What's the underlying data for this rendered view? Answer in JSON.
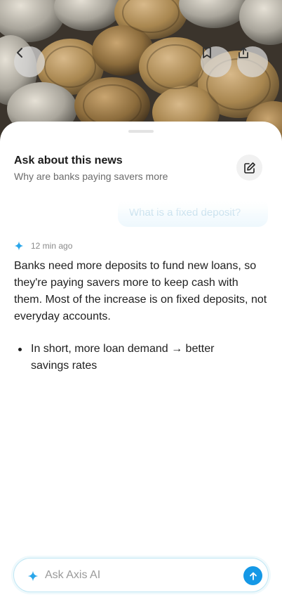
{
  "hero": {
    "image_subject": "coins-photo",
    "back_icon": "chevron-left-icon",
    "bookmark_icon": "bookmark-icon",
    "share_icon": "share-icon"
  },
  "sheet": {
    "title": "Ask about this news",
    "subtitle": "Why are banks paying savers more",
    "edit_icon": "edit-icon"
  },
  "conversation": {
    "user_message": "What is a fixed deposit?",
    "answer": {
      "assistant_icon": "sparkle-icon",
      "timestamp": "12 min ago",
      "paragraph": "Banks need more deposits to fund new loans, so they're paying savers more to keep cash with them. Most of the increase is on fixed deposits, not everyday accounts.",
      "bullets": [
        "In short, more loan demand → better savings rates"
      ]
    }
  },
  "composer": {
    "placeholder": "Ask Axis AI",
    "value": "",
    "send_icon": "arrow-up-icon"
  },
  "colors": {
    "accent": "#1598e6",
    "sparkle": "#2aa6ea",
    "input_border": "#bfe6f4"
  }
}
